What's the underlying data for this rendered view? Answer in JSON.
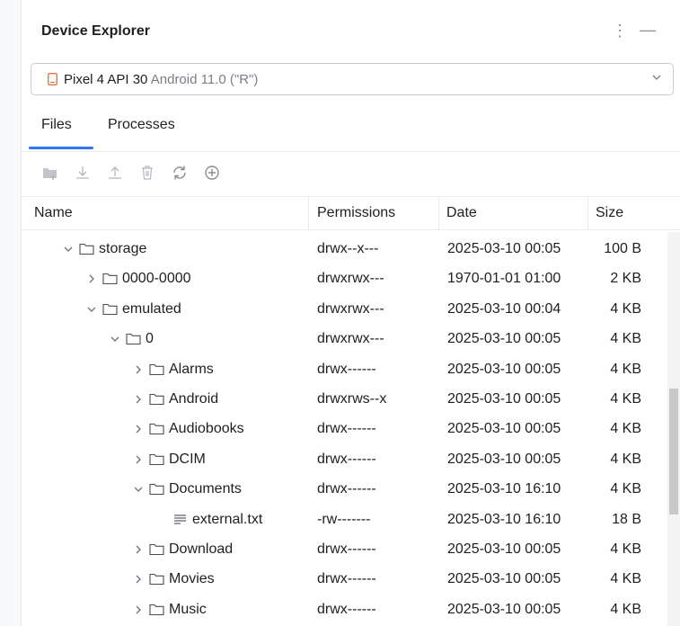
{
  "header": {
    "title": "Device Explorer"
  },
  "device": {
    "name": "Pixel 4 API 30",
    "version": "Android 11.0 (\"R\")"
  },
  "tabs": [
    {
      "label": "Files"
    },
    {
      "label": "Processes"
    }
  ],
  "columns": {
    "name": "Name",
    "permissions": "Permissions",
    "date": "Date",
    "size": "Size"
  },
  "rows": [
    {
      "name": "storage",
      "level": 0,
      "expanded": true,
      "type": "folder",
      "permissions": "drwx--x---",
      "date": "2025-03-10 00:05",
      "size": "100 B"
    },
    {
      "name": "0000-0000",
      "level": 1,
      "expanded": false,
      "type": "folder",
      "permissions": "drwxrwx---",
      "date": "1970-01-01 01:00",
      "size": "2 KB"
    },
    {
      "name": "emulated",
      "level": 1,
      "expanded": true,
      "type": "folder",
      "permissions": "drwxrwx---",
      "date": "2025-03-10 00:04",
      "size": "4 KB"
    },
    {
      "name": "0",
      "level": 2,
      "expanded": true,
      "type": "folder",
      "permissions": "drwxrwx---",
      "date": "2025-03-10 00:05",
      "size": "4 KB"
    },
    {
      "name": "Alarms",
      "level": 3,
      "expanded": false,
      "type": "folder",
      "permissions": "drwx------",
      "date": "2025-03-10 00:05",
      "size": "4 KB"
    },
    {
      "name": "Android",
      "level": 3,
      "expanded": false,
      "type": "folder",
      "permissions": "drwxrws--x",
      "date": "2025-03-10 00:05",
      "size": "4 KB"
    },
    {
      "name": "Audiobooks",
      "level": 3,
      "expanded": false,
      "type": "folder",
      "permissions": "drwx------",
      "date": "2025-03-10 00:05",
      "size": "4 KB"
    },
    {
      "name": "DCIM",
      "level": 3,
      "expanded": false,
      "type": "folder",
      "permissions": "drwx------",
      "date": "2025-03-10 00:05",
      "size": "4 KB"
    },
    {
      "name": "Documents",
      "level": 3,
      "expanded": true,
      "type": "folder",
      "permissions": "drwx------",
      "date": "2025-03-10 16:10",
      "size": "4 KB"
    },
    {
      "name": "external.txt",
      "level": 4,
      "expanded": false,
      "type": "file",
      "permissions": "-rw-------",
      "date": "2025-03-10 16:10",
      "size": "18 B"
    },
    {
      "name": "Download",
      "level": 3,
      "expanded": false,
      "type": "folder",
      "permissions": "drwx------",
      "date": "2025-03-10 00:05",
      "size": "4 KB"
    },
    {
      "name": "Movies",
      "level": 3,
      "expanded": false,
      "type": "folder",
      "permissions": "drwx------",
      "date": "2025-03-10 00:05",
      "size": "4 KB"
    },
    {
      "name": "Music",
      "level": 3,
      "expanded": false,
      "type": "folder",
      "permissions": "drwx------",
      "date": "2025-03-10 00:05",
      "size": "4 KB"
    }
  ],
  "colors": {
    "accent": "#3574f0",
    "device_icon": "#e8743b",
    "toolbar_disabled": "#b4b7bd"
  }
}
